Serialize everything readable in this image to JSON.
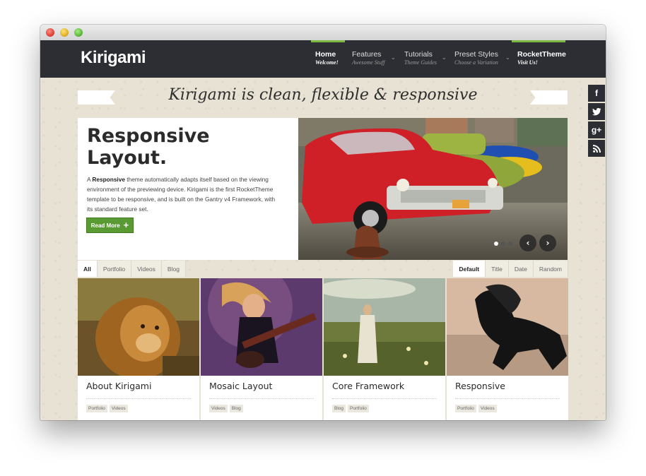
{
  "site": {
    "logo": "Kirigami"
  },
  "nav": [
    {
      "label": "Home",
      "sub": "Welcome!",
      "active": true
    },
    {
      "label": "Features",
      "sub": "Awesome Stuff"
    },
    {
      "label": "Tutorials",
      "sub": "Theme Guides"
    },
    {
      "label": "Preset Styles",
      "sub": "Choose a Variation"
    },
    {
      "label": "RocketTheme",
      "sub": "Visit Us!",
      "active": true
    }
  ],
  "tagline": "Kirigami is clean, flexible & responsive",
  "social": [
    "facebook-icon",
    "twitter-icon",
    "google-plus-icon",
    "rss-icon"
  ],
  "social_glyphs": [
    "f",
    "t",
    "g+",
    ")))"
  ],
  "hero": {
    "title_line1": "Responsive",
    "title_line2": "Layout.",
    "desc_bold": "Responsive",
    "desc_pre": "A ",
    "desc_post": " theme automatically adapts itself based on the viewing environment of the previewing device. Kirigami is the first RocketTheme template to be responsive, and is built on the Gantry v4 Framework, with its standard feature set.",
    "button": "Read More",
    "button_icon": "+",
    "slides": 3,
    "active_slide": 1,
    "prev": "‹",
    "next": "›"
  },
  "filters": [
    "All",
    "Portfolio",
    "Videos",
    "Blog"
  ],
  "sorts": [
    "Default",
    "Title",
    "Date",
    "Random"
  ],
  "cards": [
    {
      "title": "About Kirigami",
      "tags": [
        "Portfolio",
        "Videos"
      ]
    },
    {
      "title": "Mosaic Layout",
      "tags": [
        "Videos",
        "Blog"
      ]
    },
    {
      "title": "Core Framework",
      "tags": [
        "Blog",
        "Portfolio"
      ]
    },
    {
      "title": "Responsive",
      "tags": [
        "Portfolio",
        "Videos"
      ]
    }
  ],
  "colors": {
    "nav_bg": "#2d2e33",
    "accent": "#7bb844",
    "button": "#5a9a32"
  }
}
